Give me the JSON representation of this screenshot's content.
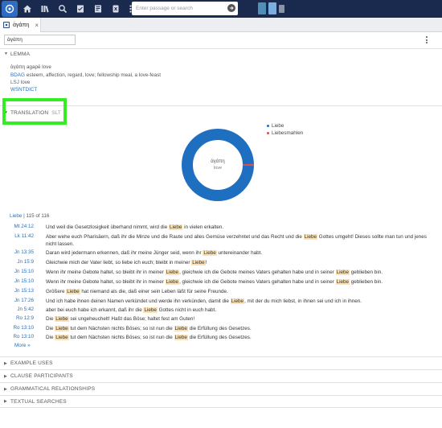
{
  "toolbar": {
    "search_placeholder": "Enter passage or search"
  },
  "tab": {
    "label": "ἀγάπη",
    "close": "×"
  },
  "word_input": {
    "value": "ἀγάπη"
  },
  "lemma": {
    "header": "LEMMA",
    "headword": "ἀγάπη agapē love",
    "entries": [
      {
        "source": "BDAG",
        "text": "esteem, affection, regard, love; fellowship meal, a love-feast"
      },
      {
        "source": "LSJ",
        "text": "love"
      },
      {
        "source": "WSNTDICT",
        "text": ""
      }
    ]
  },
  "translation": {
    "header": "TRANSLATION",
    "sub": "SLT",
    "center_word": "ἀγάπη",
    "center_gloss": "love"
  },
  "chart_data": {
    "type": "pie",
    "categories": [
      "Liebe",
      "Liebesmahlen"
    ],
    "values": [
      115,
      1
    ],
    "colors": [
      "#1f6fc1",
      "#d9534f"
    ]
  },
  "summary": {
    "label": "Liebe",
    "count": "| 115 of 116"
  },
  "verses": [
    {
      "ref": "Mt 24:12",
      "parts": [
        "Und weil die Gesetzlosigkeit überhand nimmt, wird die ",
        "Liebe",
        " in vielen erkalten."
      ]
    },
    {
      "ref": "Lk 11:42",
      "parts": [
        "Aber wehe euch Pharisäern, daß ihr die Minze und die Raute und alles Gemüse verzehntet und das Recht und die ",
        "Liebe",
        " Gottes umgeht! Dieses sollte man tun und jenes nicht lassen."
      ]
    },
    {
      "ref": "Jn 13:35",
      "parts": [
        "Daran wird jedermann erkennen, daß ihr meine Jünger seid, wenn ihr ",
        "Liebe",
        " untereinander habt."
      ]
    },
    {
      "ref": "Jn 15:9",
      "parts": [
        "Gleichwie mich der Vater liebt, so liebe ich euch; bleibt in meiner ",
        "Liebe",
        "!"
      ]
    },
    {
      "ref": "Jn 15:10",
      "parts": [
        "Wenn ihr meine Gebote haltet, so bleibt ihr in meiner ",
        "Liebe",
        ", gleichwie ich die Gebote meines Vaters gehalten habe und in seiner ",
        "Liebe",
        " geblieben bin."
      ]
    },
    {
      "ref": "Jn 15:10",
      "parts": [
        "Wenn ihr meine Gebote haltet, so bleibt ihr in meiner ",
        "Liebe",
        ", gleichwie ich die Gebote meines Vaters gehalten habe und in seiner ",
        "Liebe",
        " geblieben bin."
      ]
    },
    {
      "ref": "Jn 15:13",
      "parts": [
        "Größere ",
        "Liebe",
        " hat niemand als die, daß einer sein Leben läßt für seine Freunde."
      ]
    },
    {
      "ref": "Jn 17:26",
      "parts": [
        "Und ich habe ihnen deinen Namen verkündet und werde ihn verkünden, damit die ",
        "Liebe",
        ", mit der du mich liebst, in ihnen sei und ich in ihnen."
      ]
    },
    {
      "ref": "Jn 5:42",
      "parts": [
        "aber bei euch habe ich erkannt, daß ihr die ",
        "Liebe",
        " Gottes nicht in euch habt."
      ]
    },
    {
      "ref": "Ro 12:9",
      "parts": [
        "Die ",
        "Liebe",
        " sei ungeheuchelt! Haßt das Böse; haltet fest am Guten!"
      ]
    },
    {
      "ref": "Ro 13:10",
      "parts": [
        "Die ",
        "Liebe",
        " tut dem Nächsten nichts Böses; so ist nun die ",
        "Liebe",
        " die Erfüllung des Gesetzes."
      ]
    },
    {
      "ref": "Ro 13:10",
      "parts": [
        "Die ",
        "Liebe",
        " tut dem Nächsten nichts Böses; so ist nun die ",
        "Liebe",
        " die Erfüllung des Gesetzes."
      ]
    }
  ],
  "more_label": "More »",
  "sections": [
    "EXAMPLE USES",
    "CLAUSE PARTICIPANTS",
    "GRAMMATICAL RELATIONSHIPS",
    "TEXTUAL SEARCHES"
  ]
}
